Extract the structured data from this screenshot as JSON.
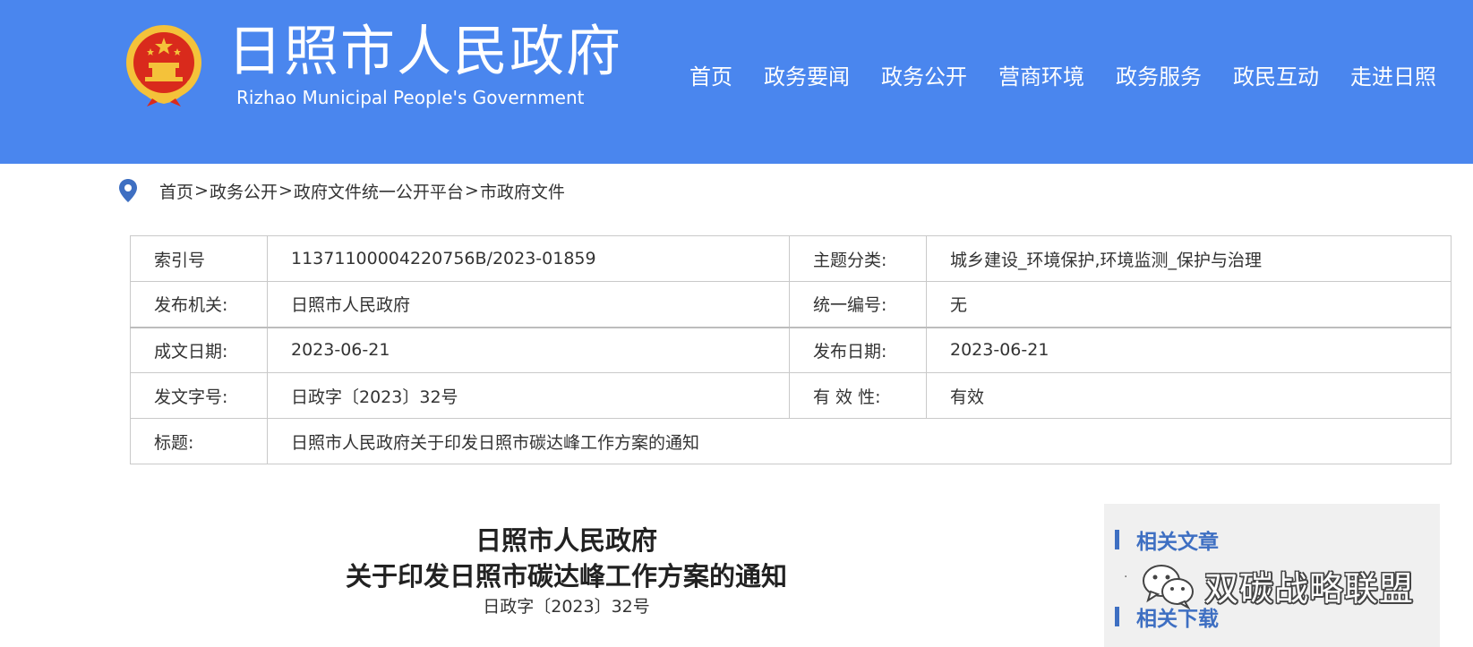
{
  "header": {
    "title": "日照市人民政府",
    "subtitle": "Rizhao Municipal People's Government",
    "nav": [
      "首页",
      "政务要闻",
      "政务公开",
      "营商环境",
      "政务服务",
      "政民互动",
      "走进日照"
    ],
    "background_color": "#4a86ee"
  },
  "breadcrumb": {
    "items": [
      "首页",
      "政务公开",
      "政府文件统一公开平台",
      "市政府文件"
    ],
    "separator": ">"
  },
  "info_table": {
    "rows": [
      {
        "label1": "索引号",
        "value1": "11371100004220756B/2023-01859",
        "label2": "主题分类:",
        "value2": "城乡建设_环境保护,环境监测_保护与治理"
      },
      {
        "label1": "发布机关:",
        "value1": "日照市人民政府",
        "label2": "统一编号:",
        "value2": "无"
      },
      {
        "label1": "成文日期:",
        "value1": "2023-06-21",
        "label2": "发布日期:",
        "value2": "2023-06-21"
      },
      {
        "label1": "发文字号:",
        "value1": "日政字〔2023〕32号",
        "label2": "有 效 性:",
        "value2": "有效"
      },
      {
        "label1": "标题:",
        "value1": "日照市人民政府关于印发日照市碳达峰工作方案的通知"
      }
    ]
  },
  "document": {
    "title_line1": "日照市人民政府",
    "title_line2": "关于印发日照市碳达峰工作方案的通知",
    "doc_number": "日政字〔2023〕32号"
  },
  "sidebar": {
    "related_articles": "相关文章",
    "related_downloads": "相关下载",
    "list_bullet": "·",
    "accent_color": "#3e6fc2"
  },
  "watermark": {
    "text": "双碳战略联盟"
  }
}
